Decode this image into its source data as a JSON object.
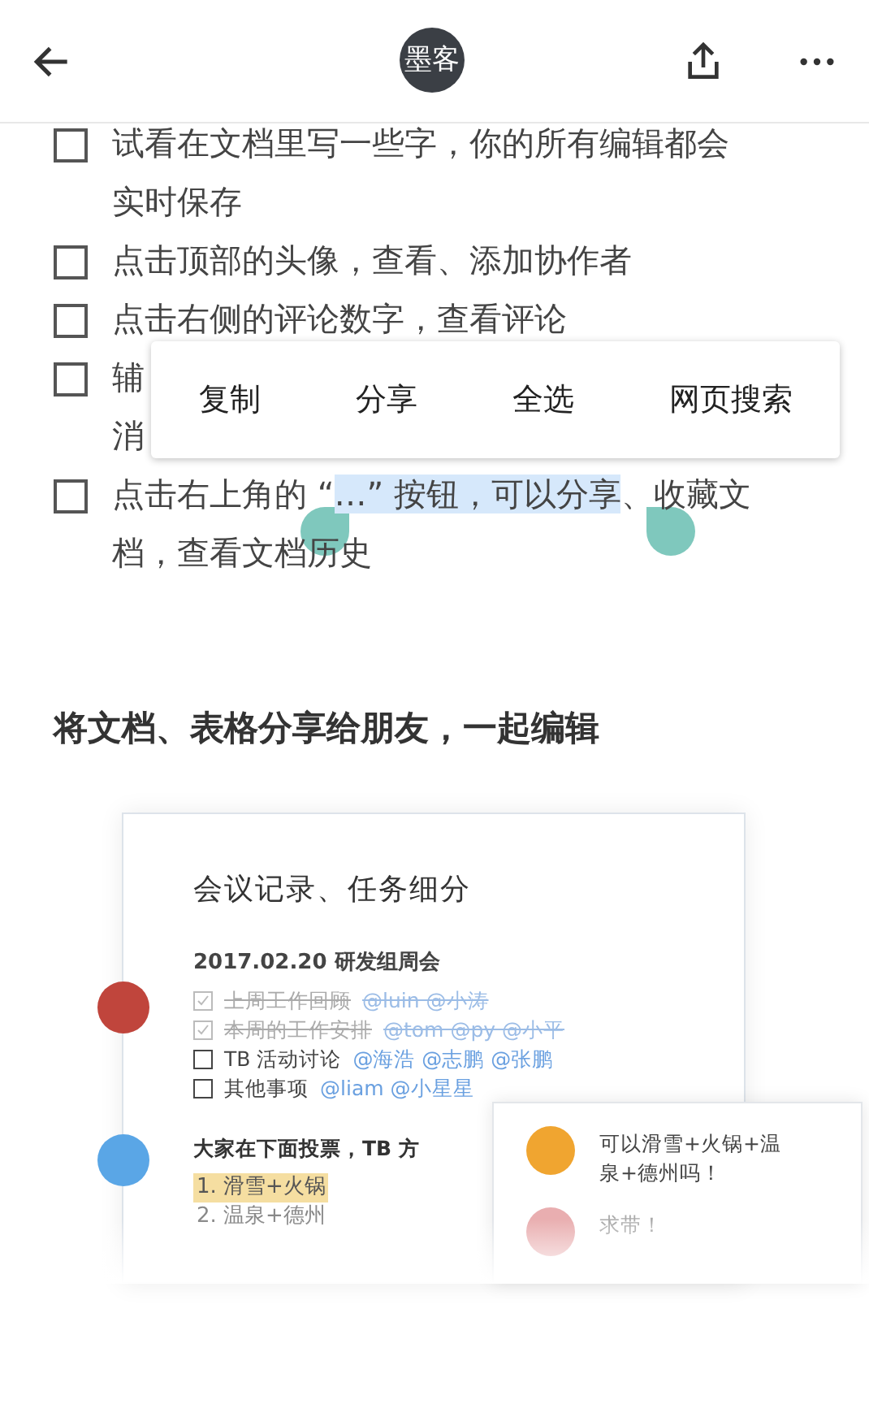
{
  "header": {
    "logo": "墨客"
  },
  "checklist": [
    {
      "checked": false,
      "lines": [
        [
          {
            "text": "试看在文档里写一些字，你的所有编辑都会",
            "selected": false
          }
        ],
        [
          {
            "text": "实时保存",
            "selected": false
          }
        ]
      ]
    },
    {
      "checked": false,
      "lines": [
        [
          {
            "text": "点击顶部的头像，查看、添加协作者",
            "selected": false
          }
        ]
      ]
    },
    {
      "checked": false,
      "lines": [
        [
          {
            "text": "点击右侧的评论数字，查看评论",
            "selected": false
          }
        ]
      ]
    },
    {
      "checked": false,
      "lines": [
        [
          {
            "text": "辅",
            "selected": false
          }
        ],
        [
          {
            "text": "消",
            "selected": false
          }
        ]
      ]
    },
    {
      "checked": false,
      "lines": [
        [
          {
            "text": "点击右上角的 “",
            "selected": false
          },
          {
            "text": "…” 按钮，可以分享",
            "selected": true
          },
          {
            "text": "、收藏文",
            "selected": false
          }
        ],
        [
          {
            "text": "档，查看文档历史",
            "selected": false
          }
        ]
      ]
    }
  ],
  "context_menu": [
    "复制",
    "分享",
    "全选",
    "网页搜索"
  ],
  "section_heading": "将文档、表格分享给朋友，一起编辑",
  "illustration": {
    "title": "会议记录、任务细分",
    "meeting": "2017.02.20 研发组周会",
    "tasks": [
      {
        "checked": true,
        "text": "上周工作回顾",
        "mentions": "@luin @小涛"
      },
      {
        "checked": true,
        "text": "本周的工作安排",
        "mentions": "@tom @py @小平"
      },
      {
        "checked": false,
        "text": "TB 活动讨论",
        "mentions": "@海浩 @志鹏 @张鹏"
      },
      {
        "checked": false,
        "text": "其他事项",
        "mentions": "@liam @小星星"
      }
    ],
    "vote_heading": "大家在下面投票，TB 方",
    "options": [
      {
        "text": "1. 滑雪+火锅",
        "selected": true
      },
      {
        "text": "2. 温泉+德州",
        "selected": false
      }
    ],
    "comments": [
      "可以滑雪+火锅+温泉+德州吗！",
      "求带！"
    ]
  }
}
